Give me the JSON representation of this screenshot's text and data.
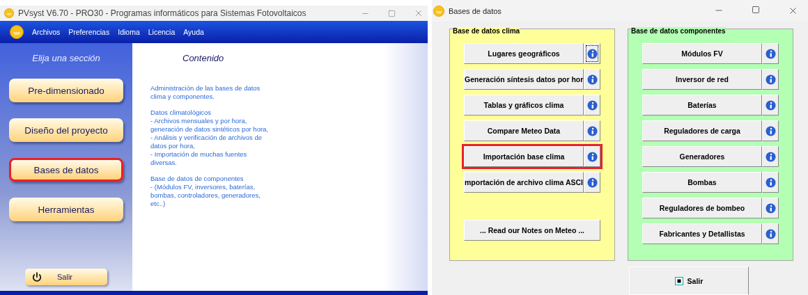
{
  "main_window": {
    "title": "PVsyst V6.70 - PRO30 - Programas informáticos para Sistemas Fotovoltaicos",
    "menu": [
      "Archivos",
      "Preferencias",
      "Idioma",
      "Licencia",
      "Ayuda"
    ],
    "sidebar": {
      "heading": "Elija una sección",
      "items": [
        {
          "label": "Pre-dimensionado",
          "highlighted": false
        },
        {
          "label": "Diseño del proyecto",
          "highlighted": false
        },
        {
          "label": "Bases de datos",
          "highlighted": true
        },
        {
          "label": "Herramientas",
          "highlighted": false
        }
      ],
      "exit_button": "Salir"
    },
    "content": {
      "heading": "Contenido",
      "paragraphs": [
        [
          "Administración de las bases de datos clima y componentes."
        ],
        [
          "Datos climatológicos",
          "- Archivos mensuales y por hora, generación de datos sintéticos por hora,",
          "- Análisis y verificación de archivos de datos por hora,",
          "- Importación de muchas fuentes diversas."
        ],
        [
          "Base de datos de componentes",
          "- (Módulos FV, inversores, baterías, bombas, controladores, generadores, etc..)"
        ]
      ]
    }
  },
  "database_window": {
    "title": "Bases de datos",
    "groups": [
      {
        "title": "Base de datos clima",
        "color": "#ffff99",
        "items": [
          {
            "label": "Lugares geográficos",
            "highlighted": false,
            "focused": true
          },
          {
            "label": "Generación síntesis datos por hor",
            "highlighted": false,
            "focused": false
          },
          {
            "label": "Tablas y gráficos clima",
            "highlighted": false,
            "focused": false
          },
          {
            "label": "Compare Meteo Data",
            "highlighted": false,
            "focused": false
          },
          {
            "label": "Importación base clima",
            "highlighted": true,
            "focused": false
          },
          {
            "label": "mportación de archivo clima ASCI",
            "highlighted": false,
            "focused": false
          }
        ],
        "footer_button": "... Read our Notes on Meteo ..."
      },
      {
        "title": "Base de datos componentes",
        "color": "#b3ffb3",
        "items": [
          {
            "label": "Módulos FV",
            "highlighted": false,
            "focused": false
          },
          {
            "label": "Inversor de red",
            "highlighted": false,
            "focused": false
          },
          {
            "label": "Baterías",
            "highlighted": false,
            "focused": false
          },
          {
            "label": "Reguladores de carga",
            "highlighted": false,
            "focused": false
          },
          {
            "label": "Generadores",
            "highlighted": false,
            "focused": false
          },
          {
            "label": "Bombas",
            "highlighted": false,
            "focused": false
          },
          {
            "label": "Reguladores de bombeo",
            "highlighted": false,
            "focused": false
          },
          {
            "label": "Fabricantes y Detallistas",
            "highlighted": false,
            "focused": false
          }
        ]
      }
    ],
    "exit_button": "Salir"
  }
}
